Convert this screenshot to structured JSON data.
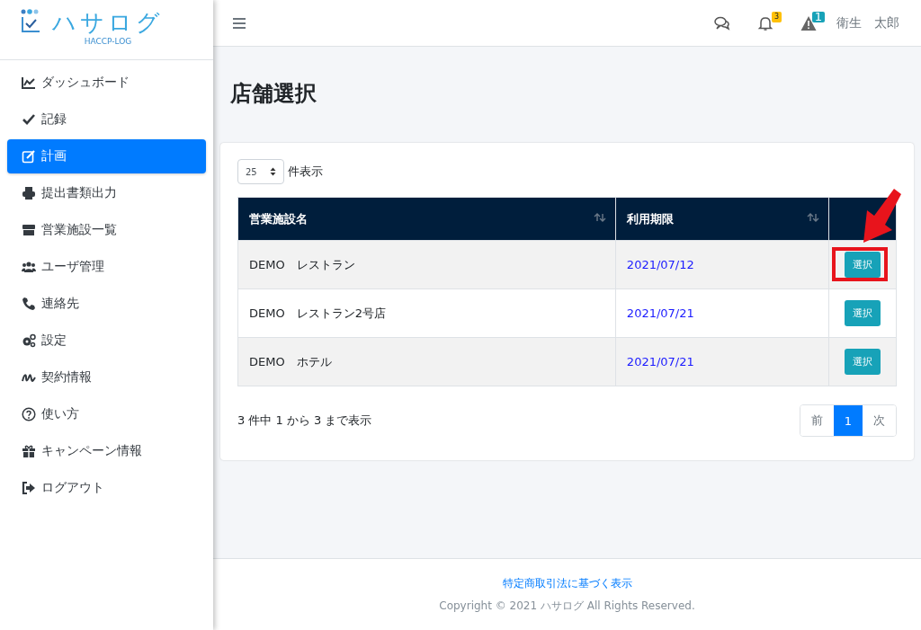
{
  "logo": {
    "title": "ハサログ",
    "subtitle": "HACCP-LOG"
  },
  "sidebar": {
    "items": [
      {
        "label": "ダッシュボード",
        "selected": false
      },
      {
        "label": "記録",
        "selected": false
      },
      {
        "label": "計画",
        "selected": true
      },
      {
        "label": "提出書類出力",
        "selected": false
      },
      {
        "label": "営業施設一覧",
        "selected": false
      },
      {
        "label": "ユーザ管理",
        "selected": false
      },
      {
        "label": "連絡先",
        "selected": false
      },
      {
        "label": "設定",
        "selected": false
      },
      {
        "label": "契約情報",
        "selected": false
      },
      {
        "label": "使い方",
        "selected": false
      },
      {
        "label": "キャンペーン情報",
        "selected": false
      },
      {
        "label": "ログアウト",
        "selected": false
      }
    ]
  },
  "topbar": {
    "notifications_badge": "3",
    "alerts_badge": "1",
    "user": "衛生　太郎"
  },
  "page_title": "店舗選択",
  "table": {
    "page_length": "25",
    "page_length_label": "件表示",
    "columns": [
      "営業施設名",
      "利用期限"
    ],
    "rows": [
      {
        "name": "DEMO　レストラン",
        "expiry": "2021/07/12",
        "action": "選択",
        "highlighted": true
      },
      {
        "name": "DEMO　レストラン2号店",
        "expiry": "2021/07/21",
        "action": "選択",
        "highlighted": false
      },
      {
        "name": "DEMO　ホテル",
        "expiry": "2021/07/21",
        "action": "選択",
        "highlighted": false
      }
    ],
    "info": "3 件中 1 から 3 まで表示",
    "pagination": {
      "previous": "前",
      "pages": [
        {
          "label": "1",
          "selected": true
        }
      ],
      "next": "次"
    }
  },
  "footer": {
    "link": "特定商取引法に基づく表示",
    "copyright": "Copyright © 2021 ハサログ All Rights Reserved."
  }
}
